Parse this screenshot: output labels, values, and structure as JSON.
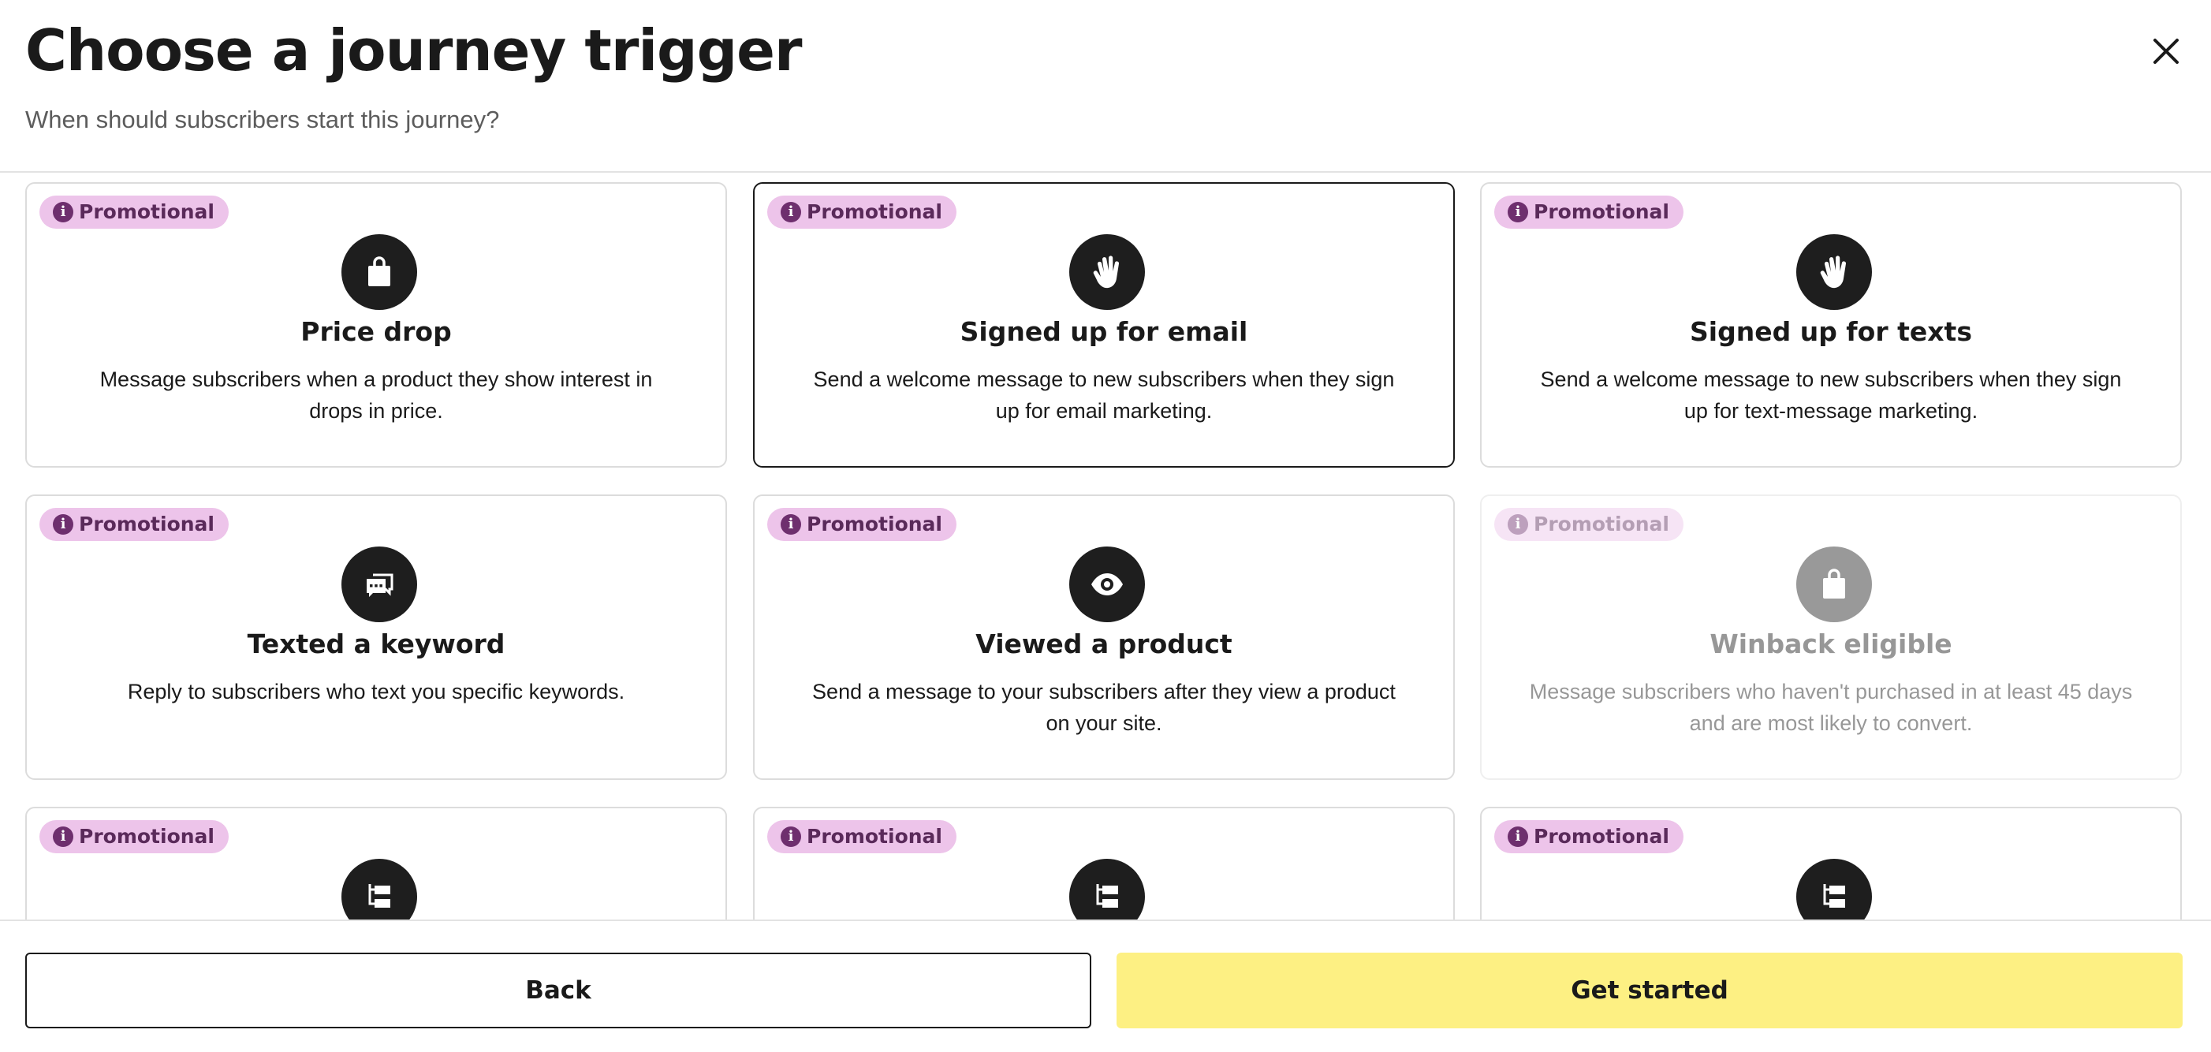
{
  "header": {
    "title": "Choose a journey trigger",
    "subtitle": "When should subscribers start this journey?",
    "close_icon": "close-icon"
  },
  "badge_label": "Promotional",
  "cards": [
    {
      "badge": "Promotional",
      "icon": "shopping-bag-icon",
      "title": "Price drop",
      "description": "Message subscribers when a product they show interest in drops in price.",
      "selected": false,
      "disabled": false
    },
    {
      "badge": "Promotional",
      "icon": "waving-hand-icon",
      "title": "Signed up for email",
      "description": "Send a welcome message to new subscribers when they sign up for email marketing.",
      "selected": true,
      "disabled": false
    },
    {
      "badge": "Promotional",
      "icon": "waving-hand-icon",
      "title": "Signed up for texts",
      "description": "Send a welcome message to new subscribers when they sign up for text-message marketing.",
      "selected": false,
      "disabled": false
    },
    {
      "badge": "Promotional",
      "icon": "chat-message-icon",
      "title": "Texted a keyword",
      "description": "Reply to subscribers who text you specific keywords.",
      "selected": false,
      "disabled": false
    },
    {
      "badge": "Promotional",
      "icon": "eye-icon",
      "title": "Viewed a product",
      "description": "Send a message to your subscribers after they view a product on your site.",
      "selected": false,
      "disabled": false
    },
    {
      "badge": "Promotional",
      "icon": "shopping-bag-icon",
      "title": "Winback eligible",
      "description": "Message subscribers who haven't purchased in at least 45 days and are most likely to convert.",
      "selected": false,
      "disabled": true
    },
    {
      "badge": "Promotional",
      "icon": "flow-branch-icon",
      "title": "",
      "description": "",
      "selected": false,
      "disabled": false
    },
    {
      "badge": "Promotional",
      "icon": "flow-branch-icon",
      "title": "",
      "description": "",
      "selected": false,
      "disabled": false
    },
    {
      "badge": "Promotional",
      "icon": "flow-branch-icon",
      "title": "",
      "description": "",
      "selected": false,
      "disabled": false
    }
  ],
  "footer": {
    "back_label": "Back",
    "start_label": "Get started"
  },
  "colors": {
    "badge_bg": "#edc4ea",
    "badge_text": "#5a2a5a",
    "icon_bg": "#1e1e1e",
    "primary_button": "#fdf083",
    "selected_border": "#1a1a1a"
  }
}
